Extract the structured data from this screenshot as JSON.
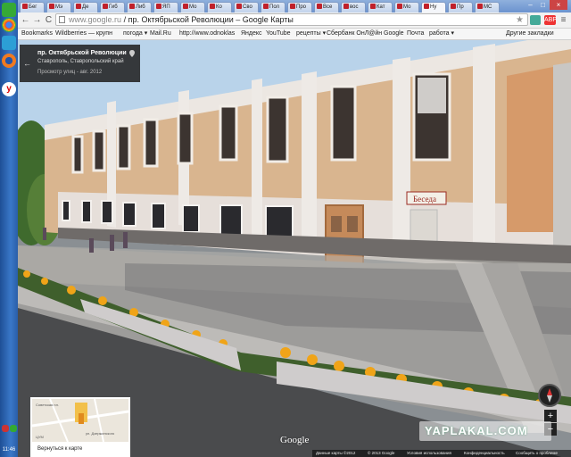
{
  "taskbar": {
    "clock": "11:46",
    "icons": [
      "chrome-icon",
      "apps-icon",
      "firefox-icon",
      "yandex-icon"
    ]
  },
  "tabs": [
    {
      "label": "Бег"
    },
    {
      "label": "Мэ"
    },
    {
      "label": "Де"
    },
    {
      "label": "Гиб"
    },
    {
      "label": "Либ"
    },
    {
      "label": "ЯП"
    },
    {
      "label": "Мо"
    },
    {
      "label": "Ко"
    },
    {
      "label": "Сво"
    },
    {
      "label": "Пол"
    },
    {
      "label": "Про"
    },
    {
      "label": "Все"
    },
    {
      "label": "вос"
    },
    {
      "label": "Кат"
    },
    {
      "label": "Мо"
    },
    {
      "label": "Ну"
    },
    {
      "label": "Пр"
    },
    {
      "label": "МС"
    }
  ],
  "toolbar": {
    "url_host": "www.google.ru",
    "url_title": "пр. Октябрьской Революции – Google Карты",
    "back_label": "←",
    "forward_label": "→",
    "reload_label": "C",
    "star_label": "★",
    "menu_label": "≡"
  },
  "bookmarks": [
    "Bookmarks",
    "Wildberries — крупн",
    "погода ▾",
    "Mail.Ru",
    "http://www.odnoklas",
    "Яндекс",
    "YouTube",
    "рецепты ▾",
    "Сбербанк ОнЛ@йн",
    "Google",
    "Почта",
    "работа ▾"
  ],
  "bookmarks_other": "Другие закладки",
  "streetview": {
    "title": "пр. Октябрьской Революции",
    "subtitle": "Ставрополь, Ставропольский край",
    "date": "Просмотр улиц - авг. 2012",
    "sign_text": "Беседа",
    "minimap_back": "Вернуться к карте",
    "minimap_labels": [
      "Советская пл.",
      "ул. Дзержинского",
      "ЦУМ"
    ],
    "google_logo": "Google",
    "footer": [
      "Данные карты ©2012",
      "© 2013 Google",
      "Условия использования",
      "Конфиденциальность",
      "Сообщить о проблеме"
    ],
    "watermark": "YAPLAKAL.COM"
  }
}
